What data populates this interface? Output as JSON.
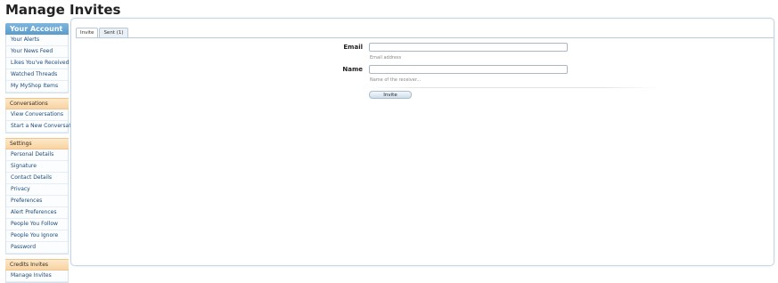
{
  "page": {
    "title": "Manage Invites"
  },
  "sidebar": {
    "header": "Your Account",
    "items": [
      {
        "label": "Your Alerts"
      },
      {
        "label": "Your News Feed"
      },
      {
        "label": "Likes You've Received"
      },
      {
        "label": "Watched Threads"
      },
      {
        "label": "My MyShop Items"
      }
    ],
    "groups": [
      {
        "title": "Conversations",
        "items": [
          {
            "label": "View Conversations"
          },
          {
            "label": "Start a New Conversation"
          }
        ]
      },
      {
        "title": "Settings",
        "items": [
          {
            "label": "Personal Details"
          },
          {
            "label": "Signature"
          },
          {
            "label": "Contact Details"
          },
          {
            "label": "Privacy"
          },
          {
            "label": "Preferences"
          },
          {
            "label": "Alert Preferences"
          },
          {
            "label": "People You Follow"
          },
          {
            "label": "People You Ignore"
          },
          {
            "label": "Password"
          }
        ]
      },
      {
        "title": "Credits Invites",
        "items": [
          {
            "label": "Manage Invites"
          }
        ]
      }
    ]
  },
  "tabs": [
    {
      "label": "Invite",
      "active": true
    },
    {
      "label": "Sent (1)",
      "active": false
    }
  ],
  "form": {
    "email_label": "Email",
    "email_value": "",
    "email_hint": "Email address",
    "name_label": "Name",
    "name_value": "",
    "name_hint": "Name of the receiver...",
    "submit_label": "Invite"
  }
}
